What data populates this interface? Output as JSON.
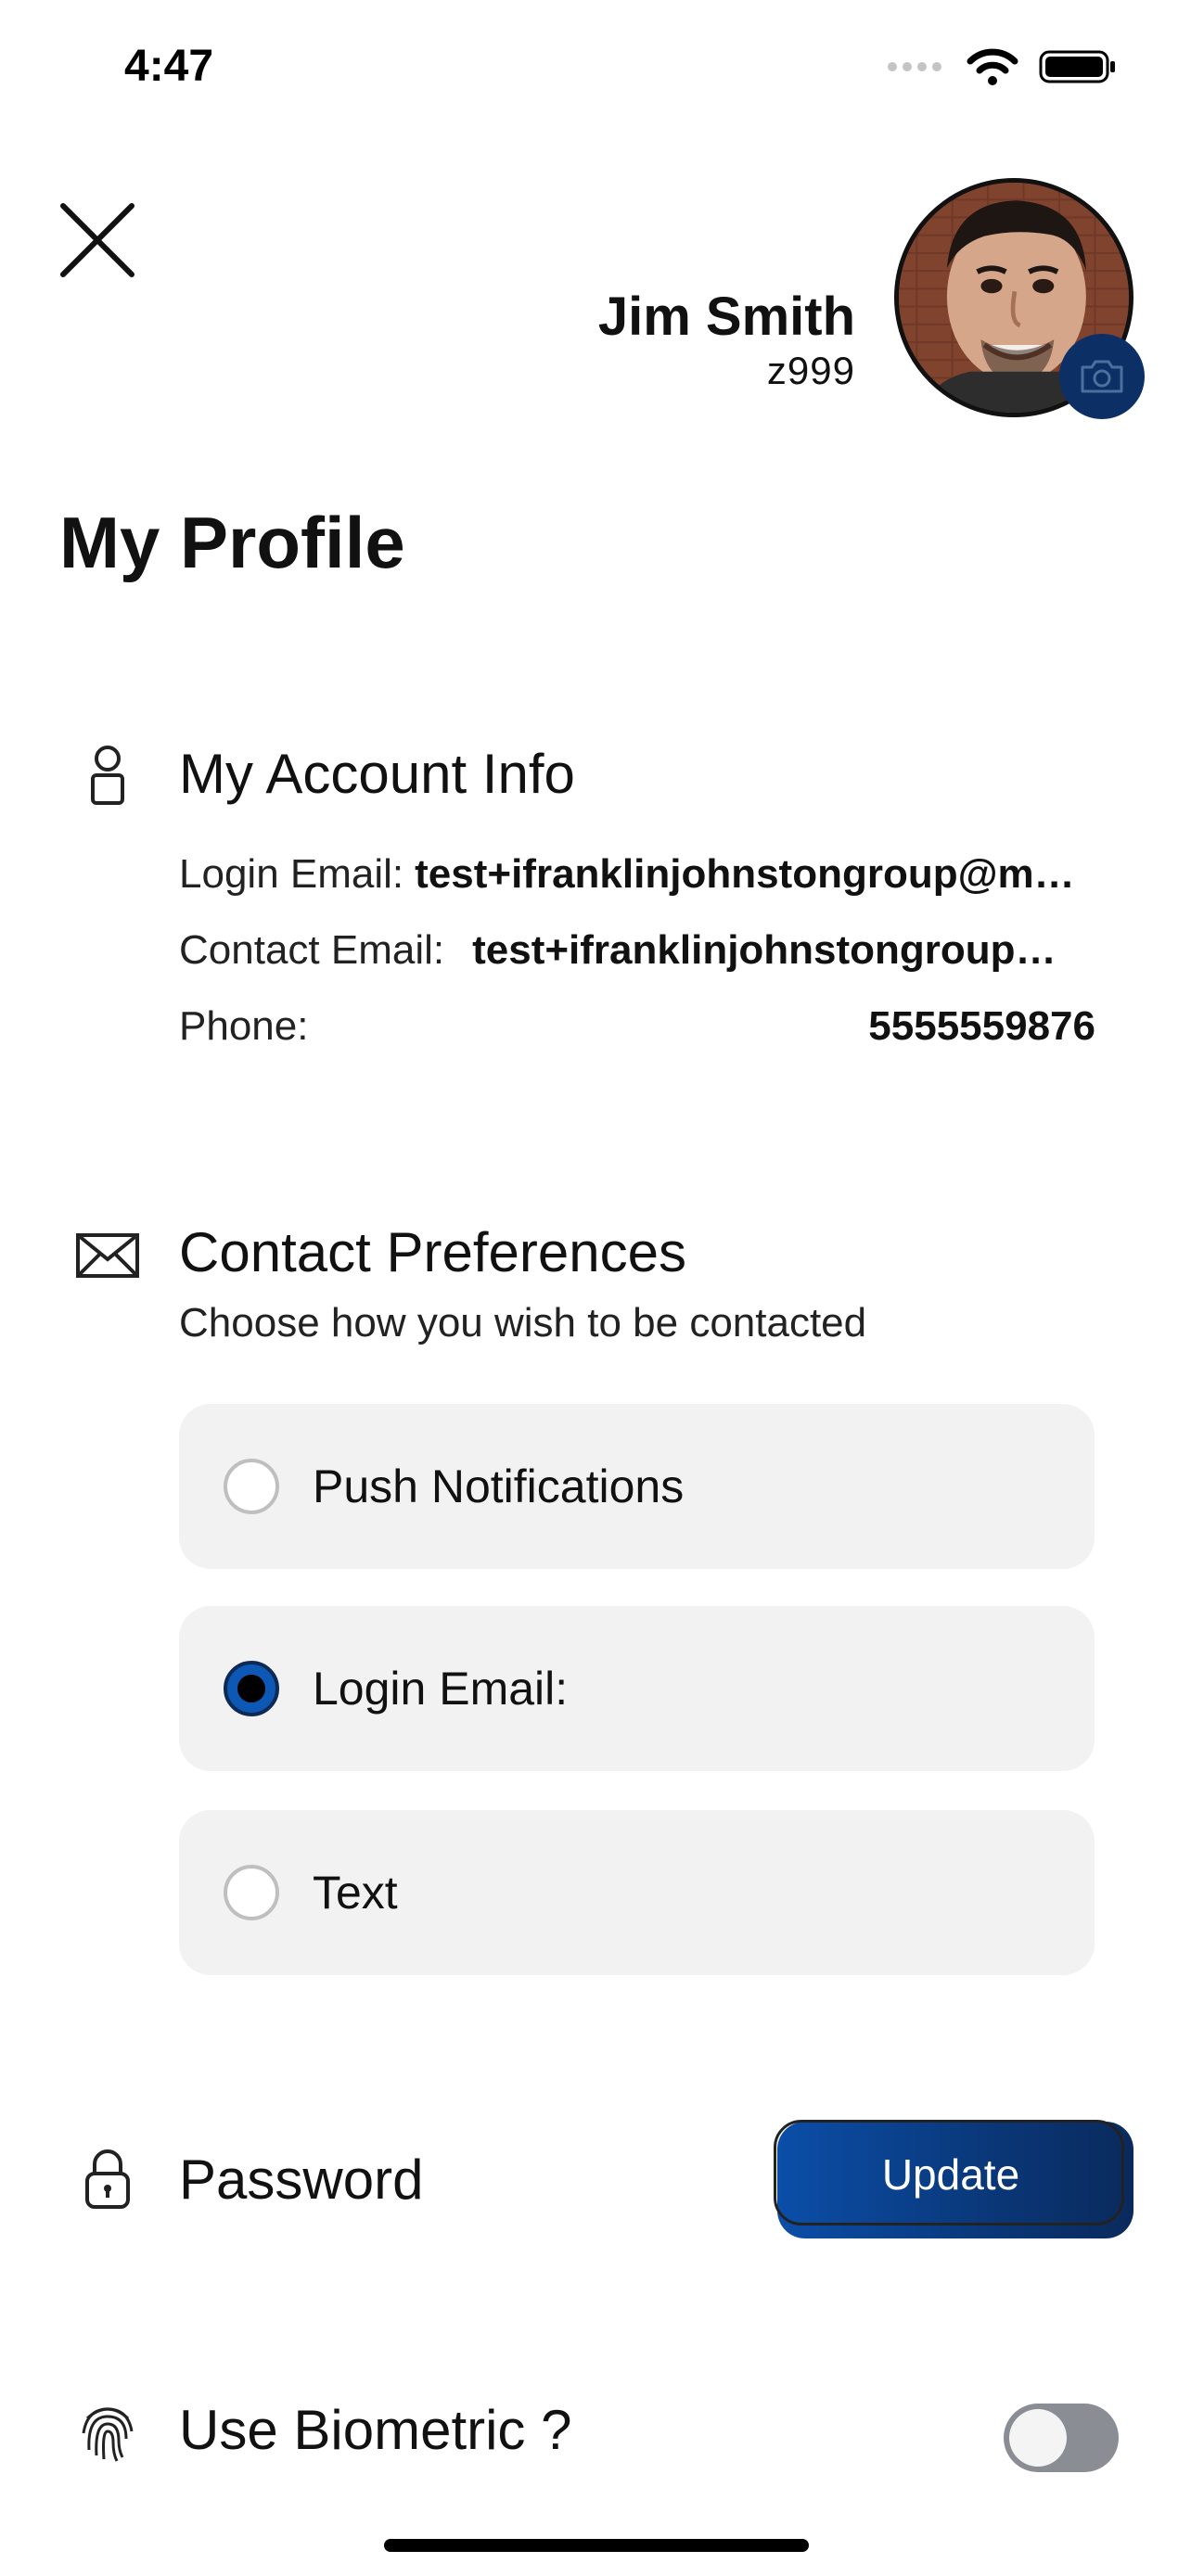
{
  "status_bar": {
    "time": "4:47"
  },
  "header": {
    "user_name": "Jim Smith",
    "user_id": "z999"
  },
  "page_title": "My Profile",
  "account_info": {
    "title": "My Account Info",
    "login_email_label": "Login Email:",
    "login_email_value": "test+ifranklinjohnstongroup@mo…",
    "contact_email_label": "Contact Email:",
    "contact_email_value": "test+ifranklinjohnstongroup@…",
    "phone_label": "Phone:",
    "phone_value": "5555559876"
  },
  "contact_preferences": {
    "title": "Contact Preferences",
    "subtitle": "Choose how you wish to be contacted",
    "options": [
      {
        "label": "Push Notifications",
        "selected": false
      },
      {
        "label": "Login Email:",
        "selected": true
      },
      {
        "label": "Text",
        "selected": false
      }
    ]
  },
  "password": {
    "label": "Password",
    "update_label": "Update"
  },
  "biometric": {
    "label": "Use Biometric ?",
    "enabled": false
  },
  "colors": {
    "accent": "#0b4ea8",
    "accent_dark": "#0c2f66",
    "option_bg": "#f2f2f2",
    "toggle_off": "#8a8d93"
  }
}
